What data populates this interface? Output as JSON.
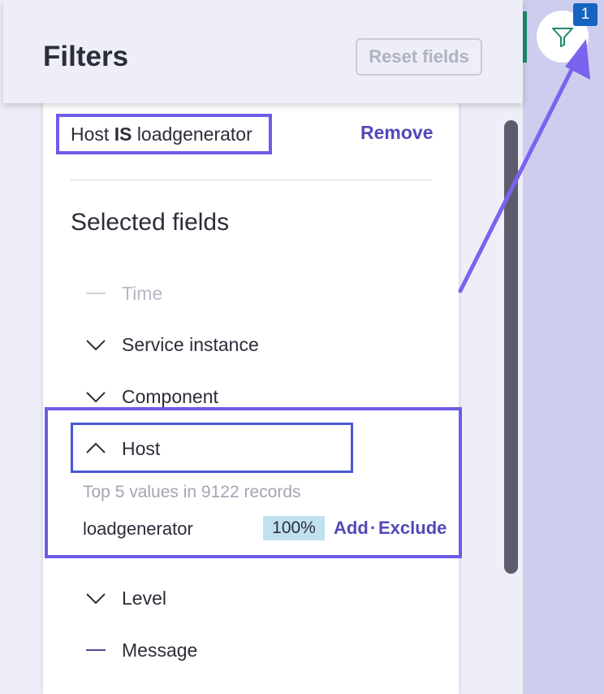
{
  "header": {
    "title": "Filters",
    "reset_label": "Reset fields"
  },
  "badge": {
    "count": "1"
  },
  "active_filter": {
    "field": "Host",
    "operator": "IS",
    "value": "loadgenerator",
    "remove_label": "Remove"
  },
  "selected_fields": {
    "heading": "Selected fields",
    "items": [
      {
        "label": "Time",
        "state": "disabled"
      },
      {
        "label": "Service instance",
        "state": "collapsed"
      },
      {
        "label": "Component",
        "state": "collapsed"
      },
      {
        "label": "Host",
        "state": "expanded"
      },
      {
        "label": "Level",
        "state": "collapsed"
      },
      {
        "label": "Message",
        "state": "none"
      }
    ]
  },
  "host_details": {
    "summary": "Top 5 values in 9122 records",
    "values": [
      {
        "value": "loadgenerator",
        "percent": "100%",
        "add_label": "Add",
        "separator": "·",
        "exclude_label": "Exclude"
      }
    ]
  },
  "colors": {
    "accent": "#6c5ce6",
    "link": "#5149b8",
    "badge": "#1565c0",
    "percent_bg": "#bfe1f0"
  },
  "icons": {
    "filter_button": "funnel-icon",
    "collapsed": "chevron-down-icon",
    "expanded": "chevron-up-icon",
    "placeholder": "dash-icon"
  }
}
